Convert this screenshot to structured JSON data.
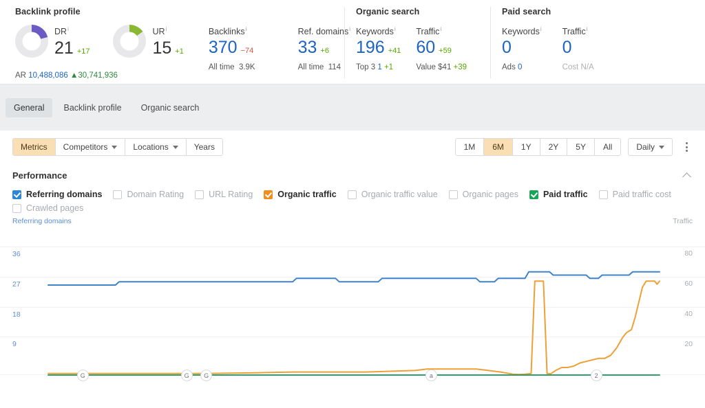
{
  "overview": {
    "backlink": {
      "title": "Backlink profile",
      "metrics": [
        {
          "label": "DR",
          "value": "21",
          "delta": "+17",
          "delta_dir": "up",
          "donut": "dr-donut",
          "pct": 21
        },
        {
          "label": "UR",
          "value": "15",
          "delta": "+1",
          "delta_dir": "up",
          "donut": "ur-donut",
          "pct": 15
        },
        {
          "label": "Backlinks",
          "value": "370",
          "delta": "−74",
          "delta_dir": "down",
          "sub_label": "All time",
          "sub_value": "3.9K"
        },
        {
          "label": "Ref. domains",
          "value": "33",
          "delta": "+6",
          "delta_dir": "up",
          "sub_label": "All time",
          "sub_value": "114"
        }
      ],
      "ar_label": "AR",
      "ar_value": "10,488,086",
      "ar_delta": "▲30,741,936"
    },
    "organic": {
      "title": "Organic search",
      "metrics": [
        {
          "label": "Keywords",
          "value": "196",
          "delta": "+41",
          "delta_dir": "up",
          "sub_label": "Top 3",
          "sub_value": "1",
          "sub_delta": "+1"
        },
        {
          "label": "Traffic",
          "value": "60",
          "delta": "+59",
          "delta_dir": "up",
          "sub_label": "Value",
          "sub_value": "$41",
          "sub_delta": "+39"
        }
      ]
    },
    "paid": {
      "title": "Paid search",
      "metrics": [
        {
          "label": "Keywords",
          "value": "0",
          "delta": "",
          "sub_label": "Ads",
          "sub_value": "0"
        },
        {
          "label": "Traffic",
          "value": "0",
          "delta": "",
          "sub_label": "Cost",
          "sub_value": "N/A"
        }
      ]
    }
  },
  "tabs": [
    {
      "label": "General",
      "active": true
    },
    {
      "label": "Backlink profile",
      "active": false
    },
    {
      "label": "Organic search",
      "active": false
    }
  ],
  "toolbar": {
    "left_buttons": [
      {
        "label": "Metrics",
        "selected": true,
        "caret": false
      },
      {
        "label": "Competitors",
        "selected": false,
        "caret": true
      },
      {
        "label": "Locations",
        "selected": false,
        "caret": true
      },
      {
        "label": "Years",
        "selected": false,
        "caret": false
      }
    ],
    "ranges": [
      {
        "label": "1M",
        "selected": false
      },
      {
        "label": "6M",
        "selected": true
      },
      {
        "label": "1Y",
        "selected": false
      },
      {
        "label": "2Y",
        "selected": false
      },
      {
        "label": "5Y",
        "selected": false
      },
      {
        "label": "All",
        "selected": false
      }
    ],
    "granularity": "Daily",
    "more_icon": "kebab-menu-icon"
  },
  "performance": {
    "title": "Performance",
    "collapse_icon": "chevron-up-icon",
    "checkboxes": [
      {
        "label": "Referring domains",
        "checked": true,
        "color": "#2b88d8"
      },
      {
        "label": "Domain Rating",
        "checked": false,
        "color": ""
      },
      {
        "label": "URL Rating",
        "checked": false,
        "color": ""
      },
      {
        "label": "Organic traffic",
        "checked": true,
        "color": "#f28c1c"
      },
      {
        "label": "Organic traffic value",
        "checked": false,
        "color": ""
      },
      {
        "label": "Organic pages",
        "checked": false,
        "color": ""
      },
      {
        "label": "Paid traffic",
        "checked": true,
        "color": "#18a558"
      },
      {
        "label": "Paid traffic cost",
        "checked": false,
        "color": ""
      },
      {
        "label": "Crawled pages",
        "checked": false,
        "color": ""
      }
    ]
  },
  "chart_data": {
    "type": "line",
    "title": "Performance",
    "xlabel": "",
    "grid": true,
    "legend_position": "top",
    "left_axis": {
      "label": "Referring domains",
      "ticks": [
        36,
        27,
        18,
        9
      ],
      "ylim": [
        0,
        40
      ],
      "color": "#5b8fd0"
    },
    "right_axis": {
      "label": "Traffic",
      "ticks": [
        80,
        60,
        40,
        20
      ],
      "ylim": [
        0,
        88
      ],
      "color": "#a8acb0"
    },
    "annotations": [
      {
        "label": "G",
        "x_pct": 5.6
      },
      {
        "label": "G",
        "x_pct": 22.6
      },
      {
        "label": "G",
        "x_pct": 25.8
      },
      {
        "label": "a",
        "x_pct": 62.6
      },
      {
        "label": "2",
        "x_pct": 89.6
      }
    ],
    "series": [
      {
        "name": "Referring domains",
        "color": "#3e83c8",
        "axis": "left",
        "points": [
          [
            0.0,
            27
          ],
          [
            11.0,
            27
          ],
          [
            11.6,
            28
          ],
          [
            40.0,
            28
          ],
          [
            40.6,
            29
          ],
          [
            47.0,
            29
          ],
          [
            47.6,
            28
          ],
          [
            54.0,
            28
          ],
          [
            54.6,
            29
          ],
          [
            70.0,
            29
          ],
          [
            70.6,
            28
          ],
          [
            73.0,
            28
          ],
          [
            73.6,
            29
          ],
          [
            78.0,
            29
          ],
          [
            78.6,
            31
          ],
          [
            82.0,
            31
          ],
          [
            82.6,
            30
          ],
          [
            88.0,
            30
          ],
          [
            88.6,
            29
          ],
          [
            90.0,
            29
          ],
          [
            90.6,
            30
          ],
          [
            95.0,
            30
          ],
          [
            95.6,
            31
          ],
          [
            100.0,
            31
          ]
        ]
      },
      {
        "name": "Organic traffic",
        "color": "#eda036",
        "axis": "right",
        "points": [
          [
            0.0,
            1
          ],
          [
            22.0,
            1
          ],
          [
            26.0,
            1
          ],
          [
            34.0,
            1.5
          ],
          [
            40.0,
            2
          ],
          [
            46.0,
            2
          ],
          [
            52.0,
            2
          ],
          [
            60.0,
            3
          ],
          [
            62.0,
            4
          ],
          [
            64.0,
            4
          ],
          [
            66.0,
            4
          ],
          [
            70.0,
            4
          ],
          [
            72.0,
            3
          ],
          [
            74.0,
            2
          ],
          [
            76.0,
            0.6
          ],
          [
            77.0,
            0.4
          ],
          [
            78.0,
            0.6
          ],
          [
            79.0,
            1
          ],
          [
            79.6,
            62
          ],
          [
            81.0,
            62
          ],
          [
            81.6,
            1
          ],
          [
            82.2,
            0.8
          ],
          [
            83.0,
            3
          ],
          [
            84.0,
            5
          ],
          [
            85.0,
            5
          ],
          [
            86.0,
            6
          ],
          [
            87.0,
            8
          ],
          [
            88.0,
            9
          ],
          [
            89.0,
            10
          ],
          [
            90.0,
            11
          ],
          [
            91.0,
            11
          ],
          [
            92.0,
            13
          ],
          [
            93.0,
            18
          ],
          [
            94.0,
            25
          ],
          [
            94.6,
            28
          ],
          [
            95.4,
            30
          ],
          [
            96.0,
            38
          ],
          [
            96.6,
            48
          ],
          [
            97.2,
            58
          ],
          [
            97.8,
            62
          ],
          [
            98.6,
            62
          ],
          [
            99.2,
            62
          ],
          [
            99.6,
            60
          ],
          [
            100.0,
            62
          ]
        ]
      },
      {
        "name": "Paid traffic",
        "color": "#2e9e6b",
        "axis": "right",
        "points": [
          [
            0.0,
            0
          ],
          [
            100.0,
            0
          ]
        ]
      }
    ]
  }
}
